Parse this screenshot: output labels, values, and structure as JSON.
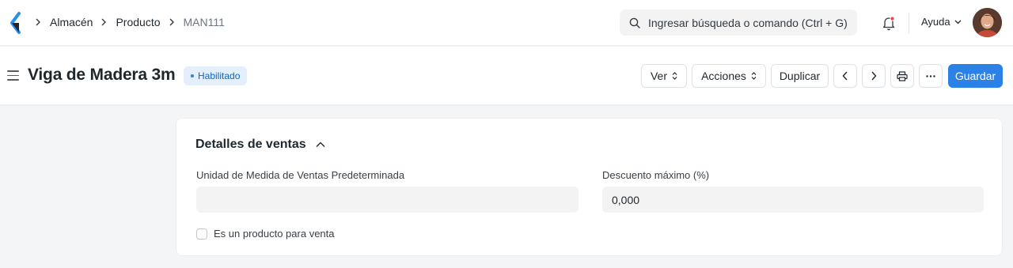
{
  "navbar": {
    "breadcrumbs": [
      "Almacén",
      "Producto",
      "MAN111"
    ],
    "search_placeholder": "Ingresar búsqueda o comando (Ctrl + G)",
    "help_label": "Ayuda"
  },
  "page": {
    "title": "Viga de Madera 3m",
    "status_badge": "Habilitado",
    "actions": {
      "view_label": "Ver",
      "actions_label": "Acciones",
      "duplicate_label": "Duplicar",
      "save_label": "Guardar"
    }
  },
  "section": {
    "title": "Detalles de ventas",
    "fields": {
      "uom_label": "Unidad de Medida de Ventas Predeterminada",
      "uom_value": "",
      "discount_label": "Descuento máximo (%)",
      "discount_value": "0,000"
    },
    "checkbox_label": "Es un producto para venta",
    "checkbox_checked": false
  },
  "colors": {
    "primary": "#2c81e6",
    "badge_bg": "#e3f0fc",
    "badge_text": "#0b66c3",
    "notification_dot": "#e24c4c"
  }
}
